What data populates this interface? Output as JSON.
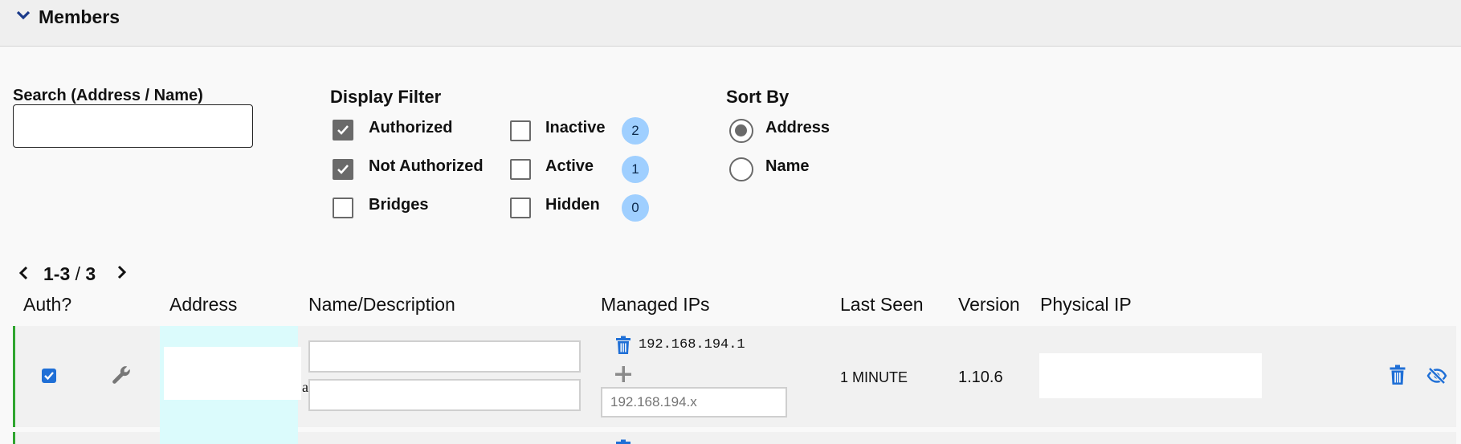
{
  "section": {
    "title": "Members"
  },
  "search": {
    "label": "Search (Address / Name)",
    "value": "",
    "placeholder": ""
  },
  "display_filter": {
    "title": "Display Filter",
    "options": [
      {
        "label": "Authorized",
        "checked": true
      },
      {
        "label": "Not Authorized",
        "checked": true
      },
      {
        "label": "Bridges",
        "checked": false
      }
    ],
    "status_options": [
      {
        "label": "Inactive",
        "checked": false,
        "count": "2"
      },
      {
        "label": "Active",
        "checked": false,
        "count": "1"
      },
      {
        "label": "Hidden",
        "checked": false,
        "count": "0"
      }
    ]
  },
  "sort_by": {
    "title": "Sort By",
    "options": [
      {
        "label": "Address",
        "selected": true
      },
      {
        "label": "Name",
        "selected": false
      }
    ]
  },
  "pagination": {
    "range": "1-3",
    "separator": " / ",
    "total": "3"
  },
  "table": {
    "columns": [
      "Auth?",
      "Address",
      "Name/Description",
      "Managed IPs",
      "Last Seen",
      "Version",
      "Physical IP"
    ],
    "rows": [
      {
        "authorized": true,
        "address": "",
        "name": "",
        "description": "",
        "description_char": "a",
        "managed_ips": [
          "192.168.194.1"
        ],
        "ip_placeholder": "192.168.194.x",
        "last_seen": "1 MINUTE",
        "version": "1.10.6",
        "physical_ip": ""
      }
    ]
  },
  "colors": {
    "accent_blue": "#1f6fd6",
    "online_green": "#2fa52f",
    "badge_bg": "#9fcfff",
    "address_bg": "#dbfbfc"
  }
}
